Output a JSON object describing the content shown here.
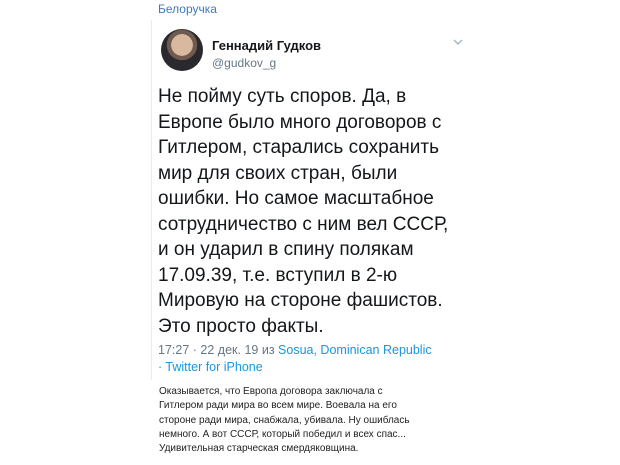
{
  "channel": {
    "name": "Белоручка"
  },
  "tweet": {
    "author_name": "Геннадий Гудков",
    "author_handle": "@gudkov_g",
    "text": "Не пойму суть споров. Да, в\nЕвропе было много договоров с\nГитлером, старались сохранить\nмир для своих стран, были\nошибки. Но самое масштабное\nсотрудничество с ним вел СССР,\nи он ударил в спину полякам\n17.09.39, т.е. вступил в 2-ю\nМировую на стороне фашистов.\nЭто просто факты.",
    "time": "17:27",
    "date": "22 дек. 19",
    "location_prefix": "из",
    "location": "Sosua, Dominican Republic",
    "client": "Twitter for iPhone"
  },
  "caption": {
    "text": "Оказывается, что Европа договора заключала с\nГитлером ради мира во всем мире. Воевала на его\nстороне ради мира, снабжала, убивала. Ну ошиблась\nнемного. А вот СССР, который победил и всех спас...\nУдивительная старческая смердяковщина."
  },
  "colors": {
    "link": "#1b95e0",
    "secondary": "#657786",
    "channel": "#3b7cc0"
  },
  "icons": {
    "menu": "chevron-down-icon",
    "avatar": "author-avatar"
  }
}
